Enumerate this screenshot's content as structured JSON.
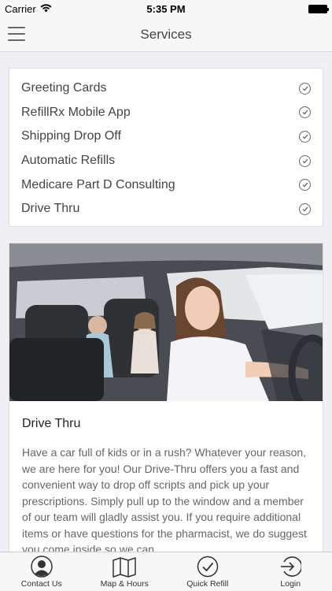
{
  "status_bar": {
    "carrier": "Carrier",
    "time": "5:35 PM"
  },
  "nav": {
    "title": "Services"
  },
  "services": [
    {
      "label": "Greeting Cards",
      "icon": "check-circle-icon"
    },
    {
      "label": "RefillRx Mobile App",
      "icon": "check-circle-icon"
    },
    {
      "label": "Shipping Drop Off",
      "icon": "check-circle-icon"
    },
    {
      "label": "Automatic Refills",
      "icon": "check-circle-icon"
    },
    {
      "label": "Medicare Part D Consulting",
      "icon": "check-circle-icon"
    },
    {
      "label": "Drive Thru",
      "icon": "check-circle-icon"
    }
  ],
  "feature": {
    "title": "Drive Thru",
    "body": "Have a car full of kids or in a rush? Whatever your reason, we are here for you! Our Drive-Thru offers you a fast and convenient way to drop off scripts and pick up your prescriptions. Simply pull up to the window and a member of our team will gladly assist you. If you require additional items or have questions for the pharmacist, we do suggest you come inside so we can"
  },
  "tabs": [
    {
      "label": "Contact Us",
      "icon": "person-icon"
    },
    {
      "label": "Map & Hours",
      "icon": "map-icon"
    },
    {
      "label": "Quick Refill",
      "icon": "check-circle-icon"
    },
    {
      "label": "Login",
      "icon": "login-icon"
    }
  ],
  "colors": {
    "background": "#efeff4",
    "bar": "#f7f7f7",
    "text": "#444444"
  }
}
